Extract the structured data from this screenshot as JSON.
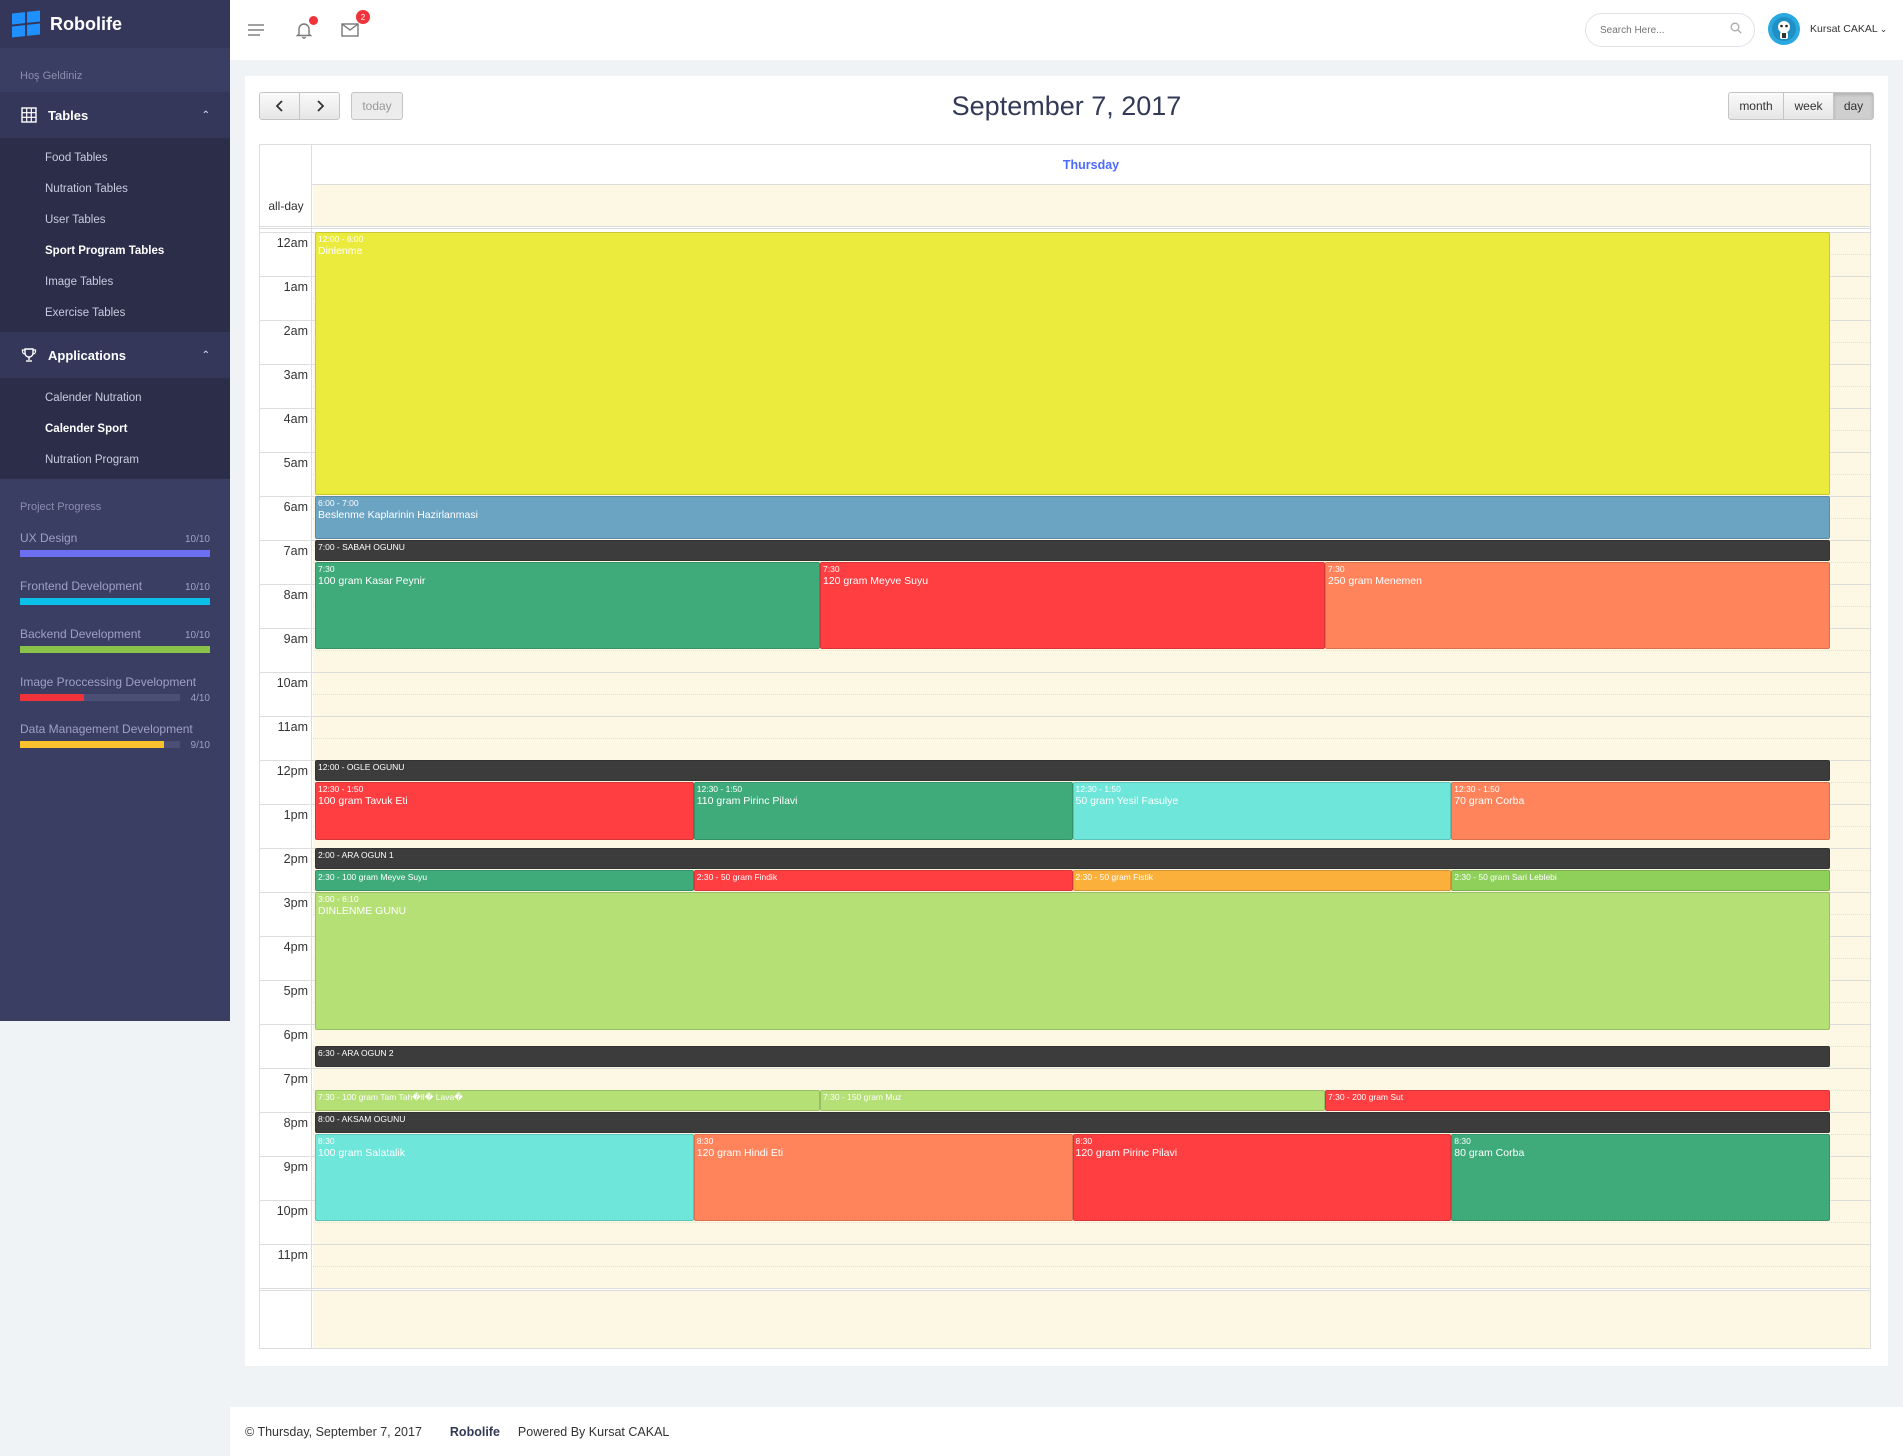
{
  "brand": {
    "name": "Robolife"
  },
  "sidebar": {
    "welcome": "Hoş Geldiniz",
    "sections": [
      {
        "label": "Tables",
        "items": [
          {
            "label": "Food Tables"
          },
          {
            "label": "Nutration Tables"
          },
          {
            "label": "User Tables"
          },
          {
            "label": "Sport Program Tables"
          },
          {
            "label": "Image Tables"
          },
          {
            "label": "Exercise Tables"
          }
        ]
      },
      {
        "label": "Applications",
        "items": [
          {
            "label": "Calender Nutration"
          },
          {
            "label": "Calender Sport"
          },
          {
            "label": "Nutration Program"
          }
        ]
      }
    ],
    "progress_title": "Project Progress",
    "progress": [
      {
        "label": "UX Design",
        "value": "10/10",
        "fraction": 1.0,
        "color": "#6c6ff0"
      },
      {
        "label": "Frontend Development",
        "value": "10/10",
        "fraction": 1.0,
        "color": "#0ac0e8"
      },
      {
        "label": "Backend Development",
        "value": "10/10",
        "fraction": 1.0,
        "color": "#8bc34a"
      },
      {
        "label": "Image Proccessing Development",
        "value": "4/10",
        "fraction": 0.4,
        "color": "#f0333a"
      },
      {
        "label": "Data Management Development",
        "value": "9/10",
        "fraction": 0.9,
        "color": "#f9c12c"
      }
    ]
  },
  "topbar": {
    "search_placeholder": "Search Here...",
    "mail_count": "2",
    "user_name": "Kursat CAKAL"
  },
  "calendar": {
    "title": "September 7, 2017",
    "today_label": "today",
    "view_buttons": {
      "month": "month",
      "week": "week",
      "day": "day"
    },
    "day_header": "Thursday",
    "allday_label": "all-day",
    "hours": [
      "12am",
      "1am",
      "2am",
      "3am",
      "4am",
      "5am",
      "6am",
      "7am",
      "8am",
      "9am",
      "10am",
      "11am",
      "12pm",
      "1pm",
      "2pm",
      "3pm",
      "4pm",
      "5pm",
      "6pm",
      "7pm",
      "8pm",
      "9pm",
      "10pm",
      "11pm"
    ],
    "events": [
      {
        "time": "12:00 - 6:00",
        "title": "Dinlenme",
        "start": 0,
        "end": 6,
        "col": 0,
        "cols": 1,
        "color": "#ebeb3e",
        "textColor": "#ffffff"
      },
      {
        "time": "6:00 - 7:00",
        "title": "Beslenme Kaplarinin Hazirlanmasi",
        "start": 6,
        "end": 7,
        "col": 0,
        "cols": 1,
        "color": "#6ba3c3",
        "textColor": "#ffffff"
      },
      {
        "time": "7:00 - SABAH OGUNU",
        "title": "",
        "start": 7,
        "end": 7.5,
        "col": 0,
        "cols": 1,
        "color": "#3c3c3c",
        "inline": true
      },
      {
        "time": "7:30",
        "title": "100 gram Kasar Peynir",
        "start": 7.5,
        "end": 9.5,
        "col": 0,
        "cols": 3,
        "color": "#3fab7b"
      },
      {
        "time": "7:30",
        "title": "120 gram Meyve Suyu",
        "start": 7.5,
        "end": 9.5,
        "col": 1,
        "cols": 3,
        "color": "#ff3e41"
      },
      {
        "time": "7:30",
        "title": "250 gram Menemen",
        "start": 7.5,
        "end": 9.5,
        "col": 2,
        "cols": 3,
        "color": "#ff845c"
      },
      {
        "time": "12:00 - OGLE OGUNU",
        "title": "",
        "start": 12,
        "end": 12.5,
        "col": 0,
        "cols": 1,
        "color": "#3c3c3c",
        "inline": true
      },
      {
        "time": "12:30 - 1:50",
        "title": "100 gram Tavuk Eti",
        "start": 12.5,
        "end": 13.83,
        "col": 0,
        "cols": 4,
        "color": "#ff3e41"
      },
      {
        "time": "12:30 - 1:50",
        "title": "110 gram Pirinc Pilavi",
        "start": 12.5,
        "end": 13.83,
        "col": 1,
        "cols": 4,
        "color": "#3fab7b"
      },
      {
        "time": "12:30 - 1:50",
        "title": "50 gram Yesil Fasulye",
        "start": 12.5,
        "end": 13.83,
        "col": 2,
        "cols": 4,
        "color": "#6ee6d9"
      },
      {
        "time": "12:30 - 1:50",
        "title": "70 gram Corba",
        "start": 12.5,
        "end": 13.83,
        "col": 3,
        "cols": 4,
        "color": "#ff845c"
      },
      {
        "time": "2:00 - ARA OGUN 1",
        "title": "",
        "start": 14,
        "end": 14.5,
        "col": 0,
        "cols": 1,
        "color": "#3c3c3c",
        "inline": true
      },
      {
        "time": "2:30 - 100 gram Meyve Suyu",
        "title": "",
        "start": 14.5,
        "end": 15,
        "col": 0,
        "cols": 4,
        "color": "#3fab7b",
        "inline": true
      },
      {
        "time": "2:30 - 50 gram Findik",
        "title": "",
        "start": 14.5,
        "end": 15,
        "col": 1,
        "cols": 4,
        "color": "#ff3e41",
        "inline": true
      },
      {
        "time": "2:30 - 50 gram Fistik",
        "title": "",
        "start": 14.5,
        "end": 15,
        "col": 2,
        "cols": 4,
        "color": "#fbb03b",
        "inline": true
      },
      {
        "time": "2:30 - 50 gram Sari Leblebi",
        "title": "",
        "start": 14.5,
        "end": 15,
        "col": 3,
        "cols": 4,
        "color": "#8ed05a",
        "inline": true
      },
      {
        "time": "3:00 - 6:10",
        "title": "DINLENME GUNU",
        "start": 15,
        "end": 18.17,
        "col": 0,
        "cols": 1,
        "color": "#b5e075"
      },
      {
        "time": "6:30 - ARA OGUN 2",
        "title": "",
        "start": 18.5,
        "end": 19,
        "col": 0,
        "cols": 1,
        "color": "#3c3c3c",
        "inline": true
      },
      {
        "time": "7:30 - 100 gram Tam Tah�ll� Lava�",
        "title": "",
        "start": 19.5,
        "end": 20,
        "col": 0,
        "cols": 3,
        "color": "#b5e075",
        "inline": true
      },
      {
        "time": "7:30 - 150 gram Muz",
        "title": "",
        "start": 19.5,
        "end": 20,
        "col": 1,
        "cols": 3,
        "color": "#b5e075",
        "inline": true
      },
      {
        "time": "7:30 - 200 gram Sut",
        "title": "",
        "start": 19.5,
        "end": 20,
        "col": 2,
        "cols": 3,
        "color": "#ff3e41",
        "inline": true
      },
      {
        "time": "8:00 - AKSAM OGUNU",
        "title": "",
        "start": 20,
        "end": 20.5,
        "col": 0,
        "cols": 1,
        "color": "#3c3c3c",
        "inline": true
      },
      {
        "time": "8:30",
        "title": "100 gram Salatalik",
        "start": 20.5,
        "end": 22.5,
        "col": 0,
        "cols": 4,
        "color": "#6ee6d9"
      },
      {
        "time": "8:30",
        "title": "120 gram Hindi Eti",
        "start": 20.5,
        "end": 22.5,
        "col": 1,
        "cols": 4,
        "color": "#ff845c"
      },
      {
        "time": "8:30",
        "title": "120 gram Pirinc Pilavi",
        "start": 20.5,
        "end": 22.5,
        "col": 2,
        "cols": 4,
        "color": "#ff3e41"
      },
      {
        "time": "8:30",
        "title": "80 gram Corba",
        "start": 20.5,
        "end": 22.5,
        "col": 3,
        "cols": 4,
        "color": "#3fab7b"
      }
    ]
  },
  "footer": {
    "copy": "© Thursday, September 7, 2017",
    "brand": "Robolife",
    "powered": "Powered By Kursat CAKAL"
  }
}
